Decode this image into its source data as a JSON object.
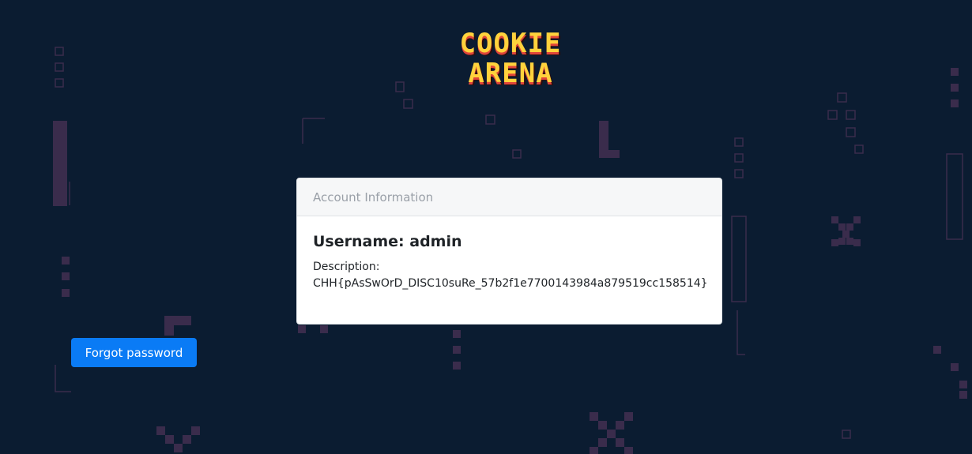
{
  "logo": {
    "line1": "COOKIE",
    "line2": "ARENA",
    "colors": {
      "face": "#ffd23c",
      "shadow": "#e0453a",
      "outline": "#2a0e0e"
    }
  },
  "card": {
    "header": "Account Information",
    "username_label": "Username:",
    "username_value": "admin",
    "description_label": "Description:",
    "description_value": "CHH{pAsSwOrD_DISC10suRe_57b2f1e7700143984a879519cc158514}"
  },
  "forgot_button": {
    "label": "Forgot password",
    "color": "#0a7bf5"
  },
  "theme": {
    "background": "#0b1c31",
    "pattern": "#3a2c4c"
  }
}
